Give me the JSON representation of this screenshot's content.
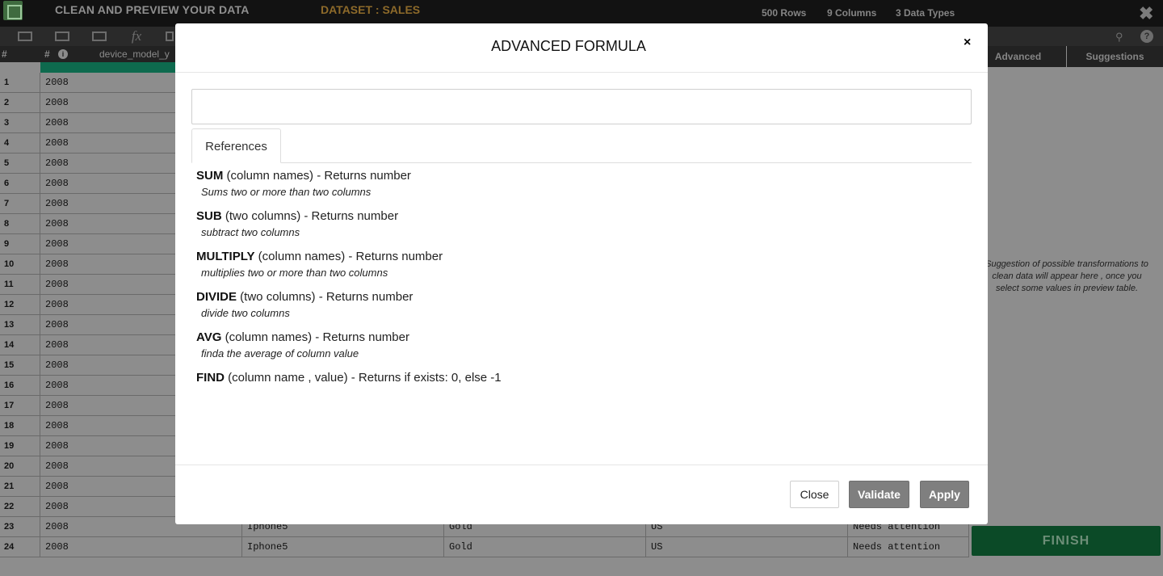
{
  "topbar": {
    "title": "CLEAN AND PREVIEW YOUR DATA",
    "dataset": "DATASET : SALES",
    "rows_stat": "500 Rows",
    "columns_stat": "9 Columns",
    "types_stat": "3 Data Types",
    "close_glyph": "✖"
  },
  "toolbar": {
    "fx_glyph": "fx",
    "search_glyph": "⚲",
    "help_glyph": "?"
  },
  "table": {
    "header_num": "#",
    "col1_type": "#",
    "col1_info": "i",
    "col1_name": "device_model_y",
    "rows": [
      {
        "n": "1",
        "year": "2008",
        "model": "",
        "color": "",
        "country": "",
        "status": ""
      },
      {
        "n": "2",
        "year": "2008",
        "model": "",
        "color": "",
        "country": "",
        "status": ""
      },
      {
        "n": "3",
        "year": "2008",
        "model": "",
        "color": "",
        "country": "",
        "status": ""
      },
      {
        "n": "4",
        "year": "2008",
        "model": "",
        "color": "",
        "country": "",
        "status": ""
      },
      {
        "n": "5",
        "year": "2008",
        "model": "",
        "color": "",
        "country": "",
        "status": ""
      },
      {
        "n": "6",
        "year": "2008",
        "model": "",
        "color": "",
        "country": "",
        "status": ""
      },
      {
        "n": "7",
        "year": "2008",
        "model": "",
        "color": "",
        "country": "",
        "status": ""
      },
      {
        "n": "8",
        "year": "2008",
        "model": "",
        "color": "",
        "country": "",
        "status": ""
      },
      {
        "n": "9",
        "year": "2008",
        "model": "",
        "color": "",
        "country": "",
        "status": ""
      },
      {
        "n": "10",
        "year": "2008",
        "model": "",
        "color": "",
        "country": "",
        "status": ""
      },
      {
        "n": "11",
        "year": "2008",
        "model": "",
        "color": "",
        "country": "",
        "status": ""
      },
      {
        "n": "12",
        "year": "2008",
        "model": "",
        "color": "",
        "country": "",
        "status": ""
      },
      {
        "n": "13",
        "year": "2008",
        "model": "",
        "color": "",
        "country": "",
        "status": ""
      },
      {
        "n": "14",
        "year": "2008",
        "model": "",
        "color": "",
        "country": "",
        "status": ""
      },
      {
        "n": "15",
        "year": "2008",
        "model": "",
        "color": "",
        "country": "",
        "status": ""
      },
      {
        "n": "16",
        "year": "2008",
        "model": "",
        "color": "",
        "country": "",
        "status": ""
      },
      {
        "n": "17",
        "year": "2008",
        "model": "",
        "color": "",
        "country": "",
        "status": ""
      },
      {
        "n": "18",
        "year": "2008",
        "model": "",
        "color": "",
        "country": "",
        "status": ""
      },
      {
        "n": "19",
        "year": "2008",
        "model": "",
        "color": "",
        "country": "",
        "status": ""
      },
      {
        "n": "20",
        "year": "2008",
        "model": "",
        "color": "",
        "country": "",
        "status": ""
      },
      {
        "n": "21",
        "year": "2008",
        "model": "",
        "color": "",
        "country": "",
        "status": ""
      },
      {
        "n": "22",
        "year": "2008",
        "model": "",
        "color": "",
        "country": "",
        "status": ""
      },
      {
        "n": "23",
        "year": "2008",
        "model": "Iphone5",
        "color": "Gold",
        "country": "US",
        "status": "Needs attention"
      },
      {
        "n": "24",
        "year": "2008",
        "model": "Iphone5",
        "color": "Gold",
        "country": "US",
        "status": "Needs attention"
      }
    ]
  },
  "right_panel": {
    "tab_advanced": "Advanced",
    "tab_suggestions": "Suggestions",
    "hint": "Suggestion of possible transformations to clean data will appear here , once you select some values in preview table.",
    "finish_label": "FINISH"
  },
  "modal": {
    "title": "ADVANCED FORMULA",
    "close_x": "×",
    "formula_value": "",
    "tab_label": "References",
    "references": [
      {
        "name": "SUM",
        "signature": " (column names) - Returns number",
        "desc": "Sums two or more than two columns"
      },
      {
        "name": "SUB",
        "signature": " (two columns) - Returns number",
        "desc": "subtract two columns"
      },
      {
        "name": "MULTIPLY",
        "signature": " (column names) - Returns number",
        "desc": "multiplies two or more than two columns"
      },
      {
        "name": "DIVIDE",
        "signature": " (two columns) - Returns number",
        "desc": "divide two columns"
      },
      {
        "name": "AVG",
        "signature": " (column names) - Returns number",
        "desc": "finda the average of column value"
      },
      {
        "name": "FIND",
        "signature": " (column name , value) - Returns if exists: 0, else -1",
        "desc": ""
      }
    ],
    "btn_close": "Close",
    "btn_validate": "Validate",
    "btn_apply": "Apply"
  },
  "colors": {
    "accent_green": "#0e6a4e",
    "finish_green": "#0b4a27",
    "dataset_gold": "#8d6a2a"
  }
}
